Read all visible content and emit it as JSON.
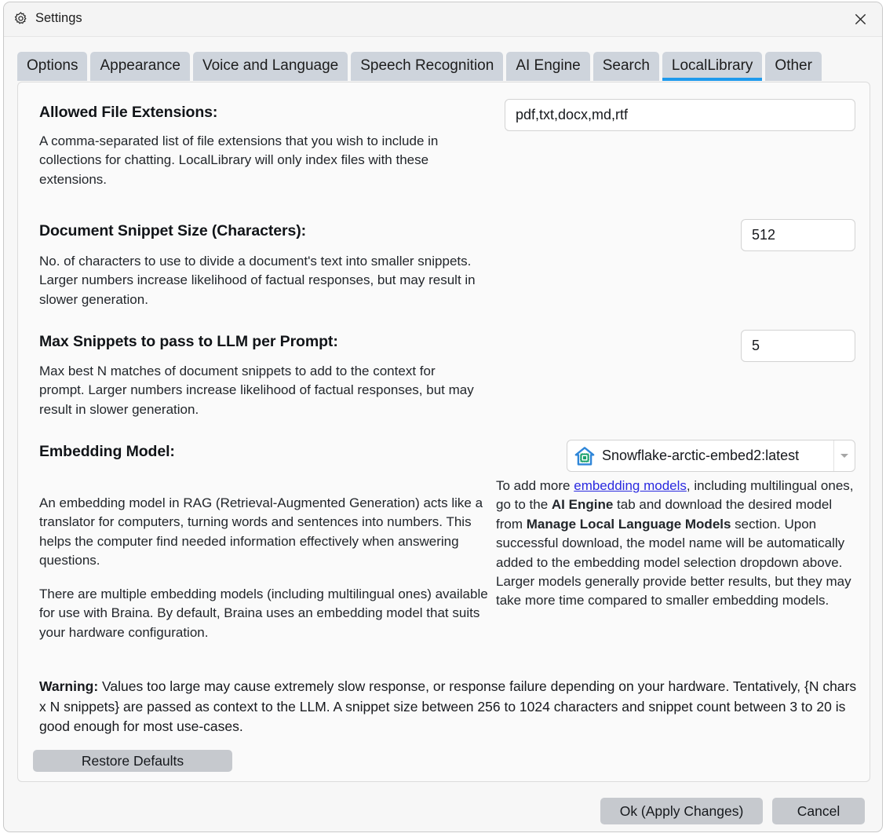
{
  "window": {
    "title": "Settings",
    "gear_icon": "gear-icon",
    "close_icon": "close-icon",
    "accent_color": "#1e9aec",
    "tab_bg_color": "#ced4dc",
    "button_bg_color": "#c6c9ce",
    "link_color": "#2a2ae0"
  },
  "tabs": [
    {
      "label": "Options",
      "active": false
    },
    {
      "label": "Appearance",
      "active": false
    },
    {
      "label": "Voice and Language",
      "active": false
    },
    {
      "label": "Speech Recognition",
      "active": false
    },
    {
      "label": "AI Engine",
      "active": false
    },
    {
      "label": "Search",
      "active": false
    },
    {
      "label": "LocalLibrary",
      "active": true
    },
    {
      "label": "Other",
      "active": false
    }
  ],
  "sections": {
    "allowed_extensions": {
      "heading": "Allowed File Extensions:",
      "description": "A comma-separated list of file extensions that you wish to include in collections for chatting. LocalLibrary will only index files with these extensions.",
      "value": "pdf,txt,docx,md,rtf",
      "placeholder": ""
    },
    "snippet_size": {
      "heading": "Document Snippet Size (Characters):",
      "description": "No. of characters to use to divide a document's text into smaller snippets. Larger numbers increase likelihood of factual responses, but may result in slower generation.",
      "value": "512",
      "placeholder": ""
    },
    "max_snippets": {
      "heading": "Max Snippets to pass to LLM per Prompt:",
      "description": "Max best N matches of document snippets to add to the context for prompt. Larger numbers increase likelihood of factual responses, but may result in slower generation.",
      "value": "5",
      "placeholder": ""
    },
    "embedding_model": {
      "heading": "Embedding Model:",
      "selected": "Snowflake-arctic-embed2:latest",
      "icon": "home-chip-icon",
      "dropdown_arrow_icon": "chevron-down-icon",
      "paragraph_1": "An embedding model in RAG (Retrieval-Augmented Generation) acts like a translator for computers, turning words and sentences into numbers. This helps the computer find needed information effectively when answering questions.",
      "paragraph_2": "There are multiple embedding models (including multilingual ones) available for use with Braina. By default, Braina uses an embedding model that suits your hardware configuration.",
      "help": {
        "part_1": "To add more ",
        "link": "embedding models",
        "part_2": ", including multilingual ones, go to the ",
        "bold_1": "AI Engine",
        "part_3": " tab and download the desired model from ",
        "bold_2": "Manage Local Language Models",
        "part_4": " section. Upon successful download, the model name will be automatically added to the embedding model selection dropdown above.",
        "part_5": "Larger models generally provide better results, but they may take more time compared to smaller embedding models."
      }
    }
  },
  "warning": {
    "label": "Warning:",
    "text": " Values too large may cause extremely slow response, or response failure depending on your hardware. Tentatively, {N chars x N snippets} are passed as context to the LLM. A snippet size between 256 to 1024 characters and snippet count between 3 to 20 is good enough for most use-cases."
  },
  "buttons": {
    "restore_defaults": "Restore Defaults",
    "ok": "Ok (Apply Changes)",
    "cancel": "Cancel"
  }
}
